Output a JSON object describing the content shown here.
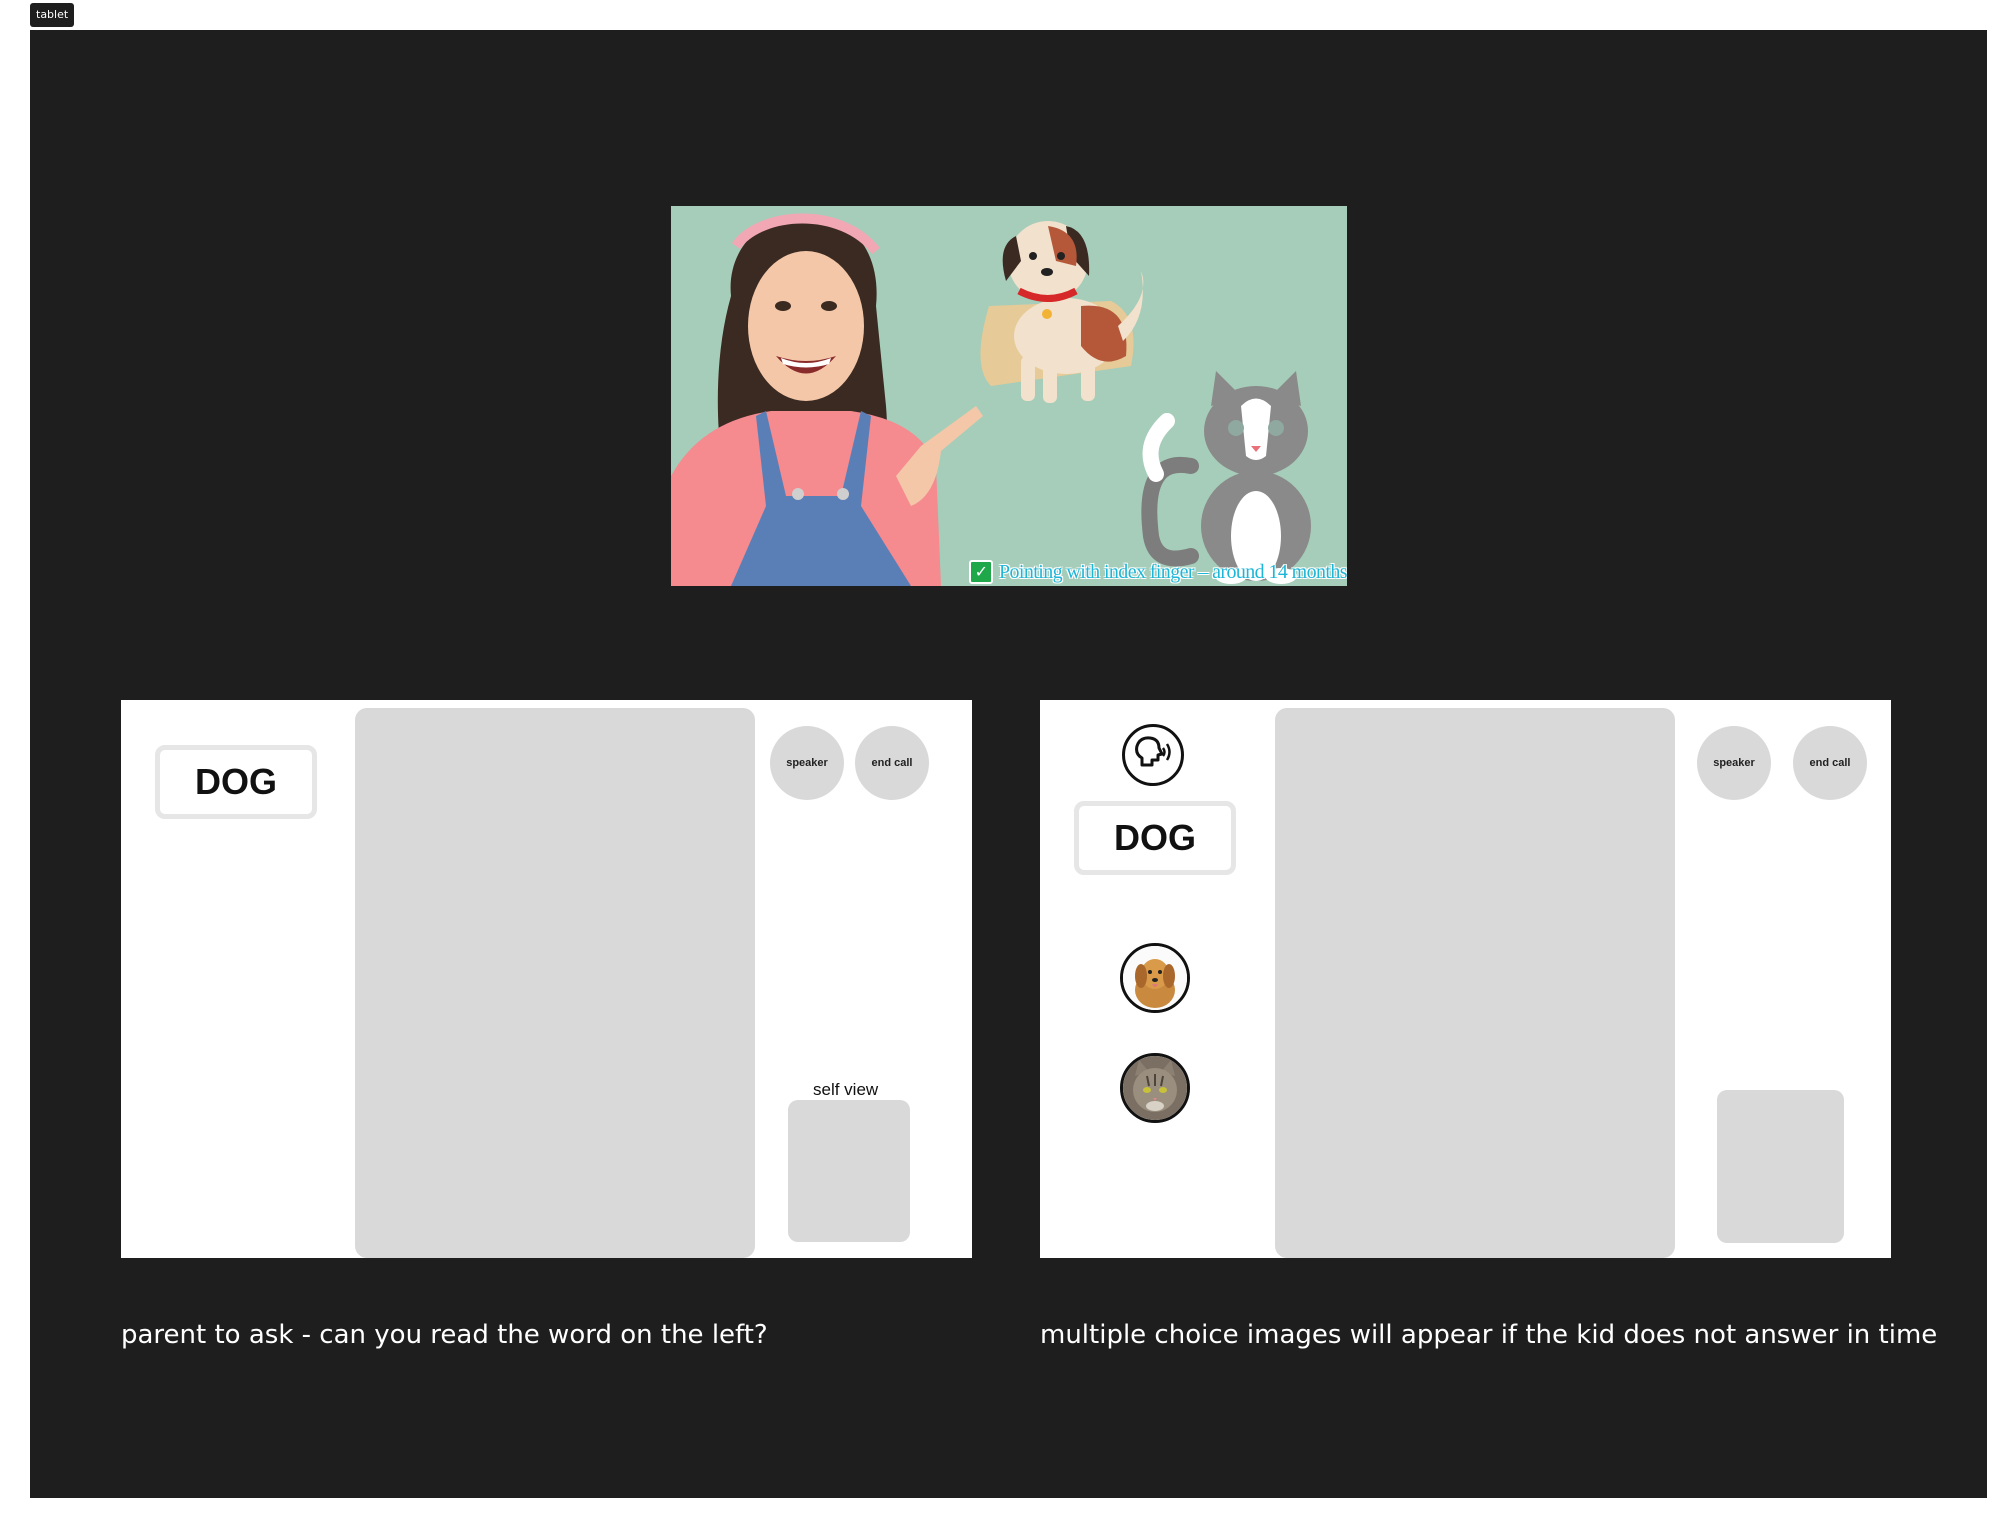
{
  "frame": {
    "tag": "tablet"
  },
  "hero": {
    "caption": "Pointing with index finger – around 14 months"
  },
  "screen_left": {
    "word": "DOG",
    "speaker_label": "speaker",
    "end_call_label": "end call",
    "self_view_label": "self view"
  },
  "screen_right": {
    "word": "DOG",
    "speaker_label": "speaker",
    "end_call_label": "end call",
    "choices": [
      "dog-image",
      "cat-image"
    ]
  },
  "captions": {
    "left": "parent to ask - can you read the word on the left?",
    "right": "multiple choice images will appear if the kid does not answer in time"
  },
  "colors": {
    "canvas": "#1e1e1e",
    "placeholder": "#d9d9d9",
    "hero_bg": "#a6cdb9"
  }
}
